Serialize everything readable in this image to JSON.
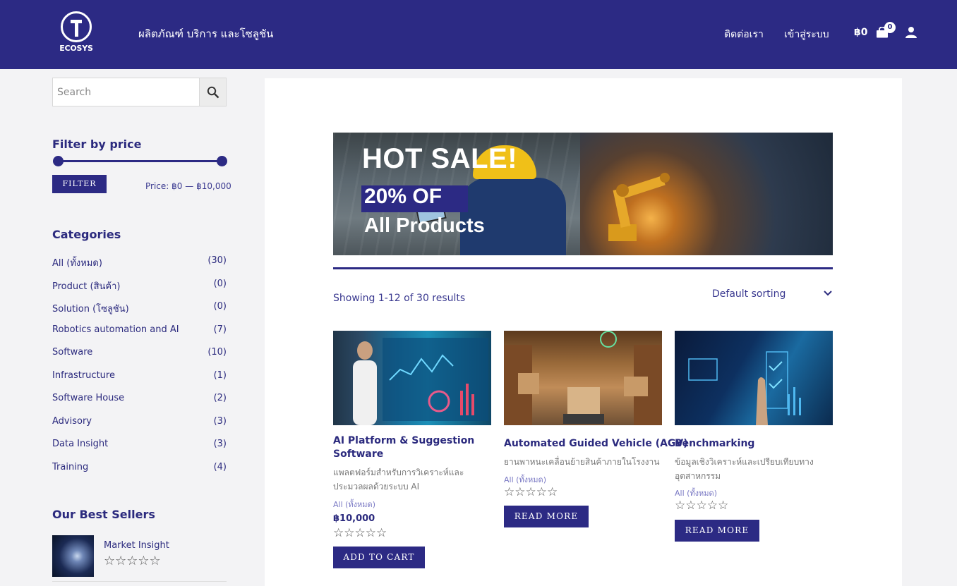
{
  "header": {
    "logo_text": "ECOSYS",
    "nav_main": "ผลิตภัณฑ์ บริการ และโซลูชัน",
    "nav_contact": "ติดต่อเรา",
    "nav_login": "เข้าสู่ระบบ",
    "cart_total": "฿0",
    "cart_count": "0",
    "icons": [
      "shopping-bag-icon",
      "user-icon"
    ]
  },
  "sidebar": {
    "search": {
      "placeholder": "Search",
      "icon": "search-icon"
    },
    "filter": {
      "heading": "Filter by price",
      "button_label": "FILTER",
      "price_label": "Price:",
      "price_min": "฿0",
      "price_sep": "—",
      "price_max": "฿10,000",
      "range_min_fraction": 0,
      "range_max_fraction": 1
    },
    "categories_heading": "Categories",
    "categories": [
      {
        "label": "All (ทั้งหมด)",
        "count": "(30)"
      },
      {
        "label": "Product (สินค้า)",
        "count": "(0)"
      },
      {
        "label": "Solution (โซลูชัน)",
        "count": "(0)"
      },
      {
        "label": "Robotics automation and AI",
        "count": "(7)"
      },
      {
        "label": "Software",
        "count": "(10)"
      },
      {
        "label": "Infrastructure",
        "count": "(1)"
      },
      {
        "label": "Software House",
        "count": "(2)"
      },
      {
        "label": "Advisory",
        "count": "(3)"
      },
      {
        "label": "Data Insight",
        "count": "(3)"
      },
      {
        "label": "Training",
        "count": "(4)"
      }
    ],
    "best_sellers": {
      "heading": "Our Best Sellers",
      "items": [
        {
          "name": "Market Insight",
          "rating": 0
        }
      ]
    }
  },
  "main": {
    "banner": {
      "line1": "HOT SALE!",
      "line2": "20% OF",
      "line3": "All Products"
    },
    "result_count": "Showing 1-12 of 30 results",
    "sorting": "Default sorting",
    "products": [
      {
        "title_line1": "AI Platform & Suggestion",
        "title_line2": "Software",
        "desc_line1": "แพลตฟอร์มสำหรับการวิเคราะห์และ",
        "desc_line2": "ประมวลผลด้วยระบบ AI",
        "category": "All (ทั้งหมด)",
        "price": "฿10,000",
        "rating": 0,
        "button": "ADD TO CART"
      },
      {
        "title_line1": "Automated Guided Vehicle (AGV)",
        "desc_line1": "ยานพาหนะเคลื่อนย้ายสินค้าภายในโรงงาน",
        "category": "All (ทั้งหมด)",
        "rating": 0,
        "button": "READ MORE"
      },
      {
        "title_line1": "Benchmarking",
        "desc_line1": "ข้อมูลเชิงวิเคราะห์และเปรียบเทียบทาง",
        "desc_line2": "อุตสาหกรรม",
        "category": "All (ทั้งหมด)",
        "rating": 0,
        "button": "READ MORE"
      }
    ],
    "stars_glyph": "☆☆☆☆☆"
  },
  "colors": {
    "brand": "#2c2a84",
    "background": "#f3f3f5",
    "panel": "#ffffff"
  }
}
